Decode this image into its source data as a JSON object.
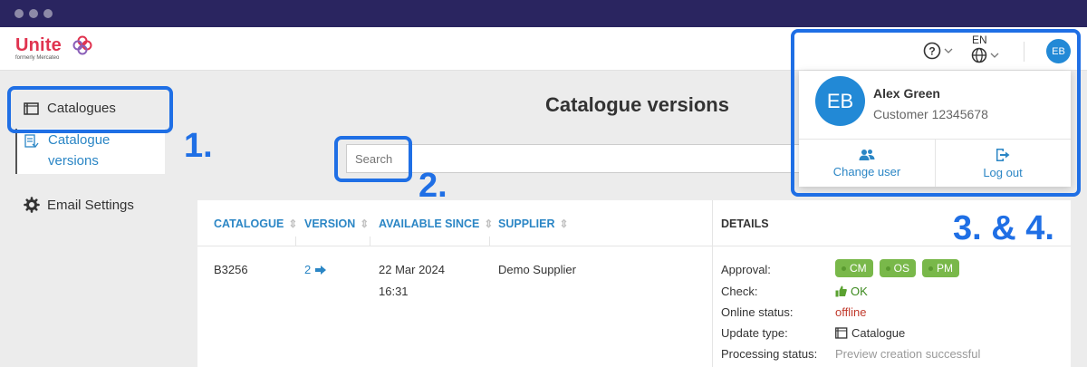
{
  "app": {
    "logo_text": "Unite",
    "logo_subtext": "formerly Mercateo"
  },
  "header": {
    "language": "EN",
    "avatar_initials": "EB"
  },
  "sidebar": {
    "items": [
      {
        "label": "Catalogues",
        "icon": "catalogue-icon"
      },
      {
        "label": "Catalogue versions",
        "icon": "catalogue-versions-icon"
      },
      {
        "label": "Email Settings",
        "icon": "gear-icon"
      }
    ]
  },
  "main": {
    "title": "Catalogue versions",
    "search": {
      "placeholder": "Search",
      "value": ""
    }
  },
  "table": {
    "columns": [
      "CATALOGUE",
      "VERSION",
      "AVAILABLE SINCE",
      "SUPPLIER",
      "DETAILS"
    ],
    "rows": [
      {
        "catalogue": "B3256",
        "version": "2",
        "available_date": "22 Mar 2024",
        "available_time": "16:31",
        "supplier": "Demo Supplier",
        "details": {
          "approval_label": "Approval:",
          "approval_badges": [
            "CM",
            "OS",
            "PM"
          ],
          "check_label": "Check:",
          "check_value": "OK",
          "online_label": "Online status:",
          "online_value": "offline",
          "update_label": "Update type:",
          "update_value": "Catalogue",
          "processing_label": "Processing status:",
          "processing_value": "Preview creation successful"
        }
      }
    ]
  },
  "user_menu": {
    "avatar_initials": "EB",
    "name": "Alex Green",
    "customer": "Customer 12345678",
    "change_user_label": "Change user",
    "logout_label": "Log out"
  },
  "annotations": {
    "step1": "1.",
    "step2": "2.",
    "step3": "3. & 4."
  },
  "colors": {
    "accent": "#2b86c5",
    "highlight": "#1f6fe5",
    "titlebar": "#2a2560",
    "brand": "#e0334f",
    "badge": "#79b84a",
    "offline": "#c0392b"
  }
}
